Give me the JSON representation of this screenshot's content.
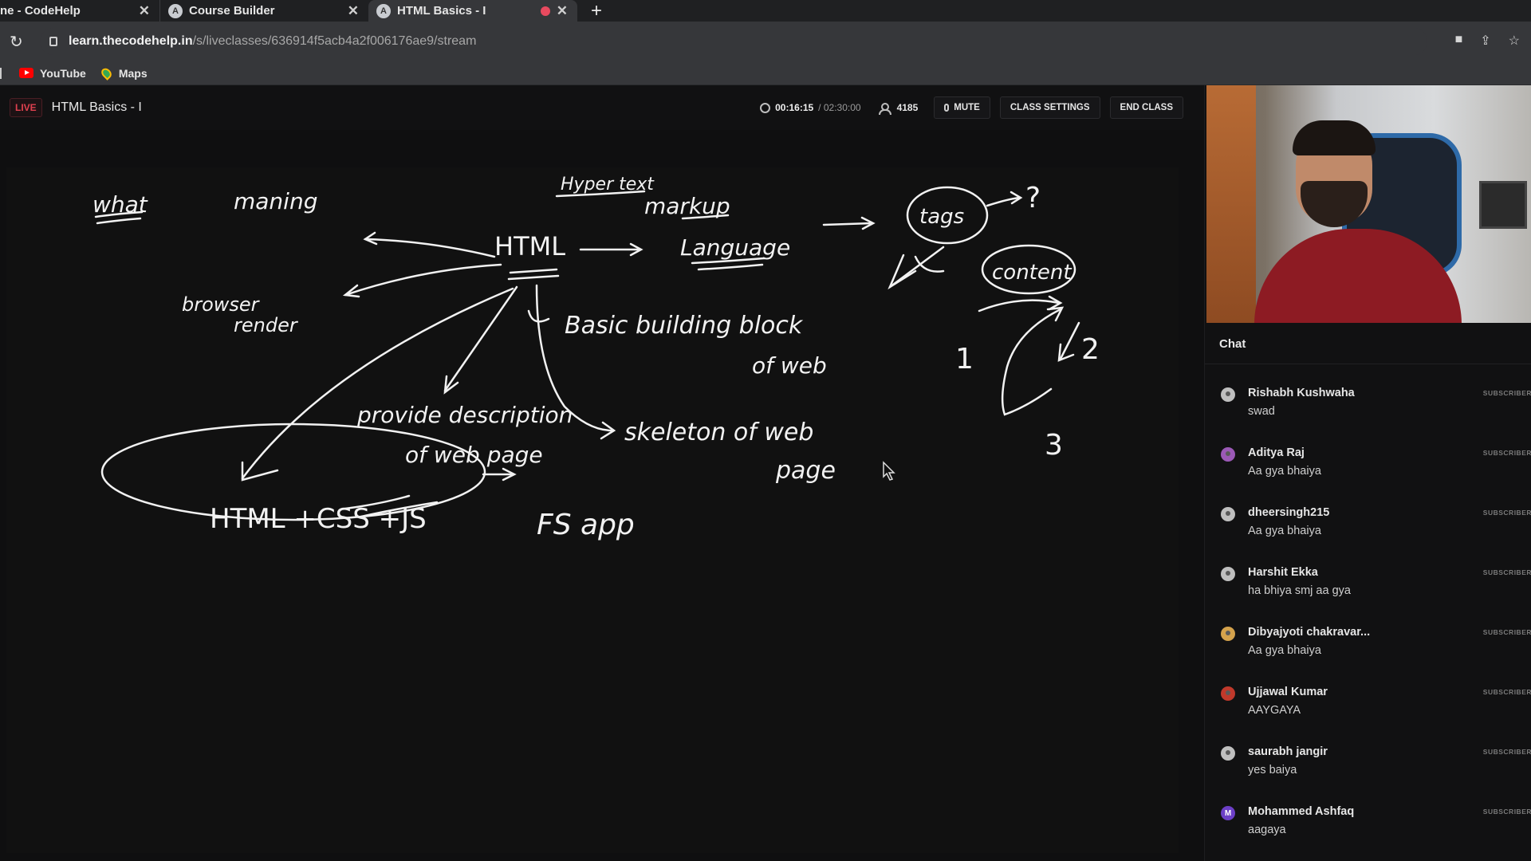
{
  "browser": {
    "tabs": [
      {
        "label": "ne - CodeHelp",
        "close": "✕"
      },
      {
        "label": "Course Builder",
        "close": "✕",
        "icon": "codehelp-icon"
      },
      {
        "label": "HTML Basics - I",
        "close": "✕",
        "icon": "codehelp-icon",
        "active": true
      }
    ],
    "new_tab": "+",
    "url_host": "learn.thecodehelp.in",
    "url_path": "/s/liveclasses/636914f5acb4a2f006176ae9/stream",
    "bookmarks": [
      {
        "label": "YouTube",
        "icon": "youtube-icon"
      },
      {
        "label": "Maps",
        "icon": "maps-icon"
      }
    ]
  },
  "classbar": {
    "live": "LIVE",
    "title": "HTML Basics - I",
    "elapsed": "00:16:15",
    "total": "/ 02:30:00",
    "viewers": "4185",
    "mute_label": "MUTE",
    "settings_label": "CLASS SETTINGS",
    "end_label": "END CLASS"
  },
  "board": {
    "what": "what",
    "meaning": "maning",
    "browser_render_1": "browser",
    "browser_render_2": "render",
    "hypertext": "Hyper text",
    "markup": "markup",
    "html": "HTML",
    "language": "Language",
    "tags": "tags",
    "question": "?",
    "content": "content",
    "basic_1": "Basic building block",
    "basic_2": "of web",
    "n1": "1",
    "n2": "2",
    "n3": "3",
    "provide_1": "provide description",
    "provide_2": "of web page",
    "skeleton_1": "skeleton of web",
    "skeleton_2": "page",
    "stack": "HTML +CSS +JS",
    "fs": "FS app"
  },
  "chat": {
    "title": "Chat",
    "badge": "SUBSCRIBER",
    "messages": [
      {
        "name": "Rishabh Kushwaha",
        "text": "swad",
        "color": "#bfbfbf"
      },
      {
        "name": "Aditya Raj",
        "text": "Aa gya bhaiya",
        "color": "#9b59b6"
      },
      {
        "name": "dheersingh215",
        "text": "Aa gya bhaiya",
        "color": "#bfbfbf"
      },
      {
        "name": "Harshit Ekka",
        "text": "ha bhiya smj aa gya",
        "color": "#bfbfbf"
      },
      {
        "name": "Dibyajyoti chakravar...",
        "text": "Aa gya bhaiya",
        "color": "#d4a24c"
      },
      {
        "name": "Ujjawal Kumar",
        "text": "AAYGAYA",
        "color": "#c0392b"
      },
      {
        "name": "saurabh jangir",
        "text": "yes baiya",
        "color": "#bfbfbf"
      },
      {
        "name": "Mohammed Ashfaq",
        "text": "aagaya",
        "color": "#6c3fc7",
        "initial": "M"
      }
    ]
  },
  "colors": {
    "live_red": "#e0404f",
    "panel_bg": "#111112",
    "chrome_bg": "#36373a"
  }
}
